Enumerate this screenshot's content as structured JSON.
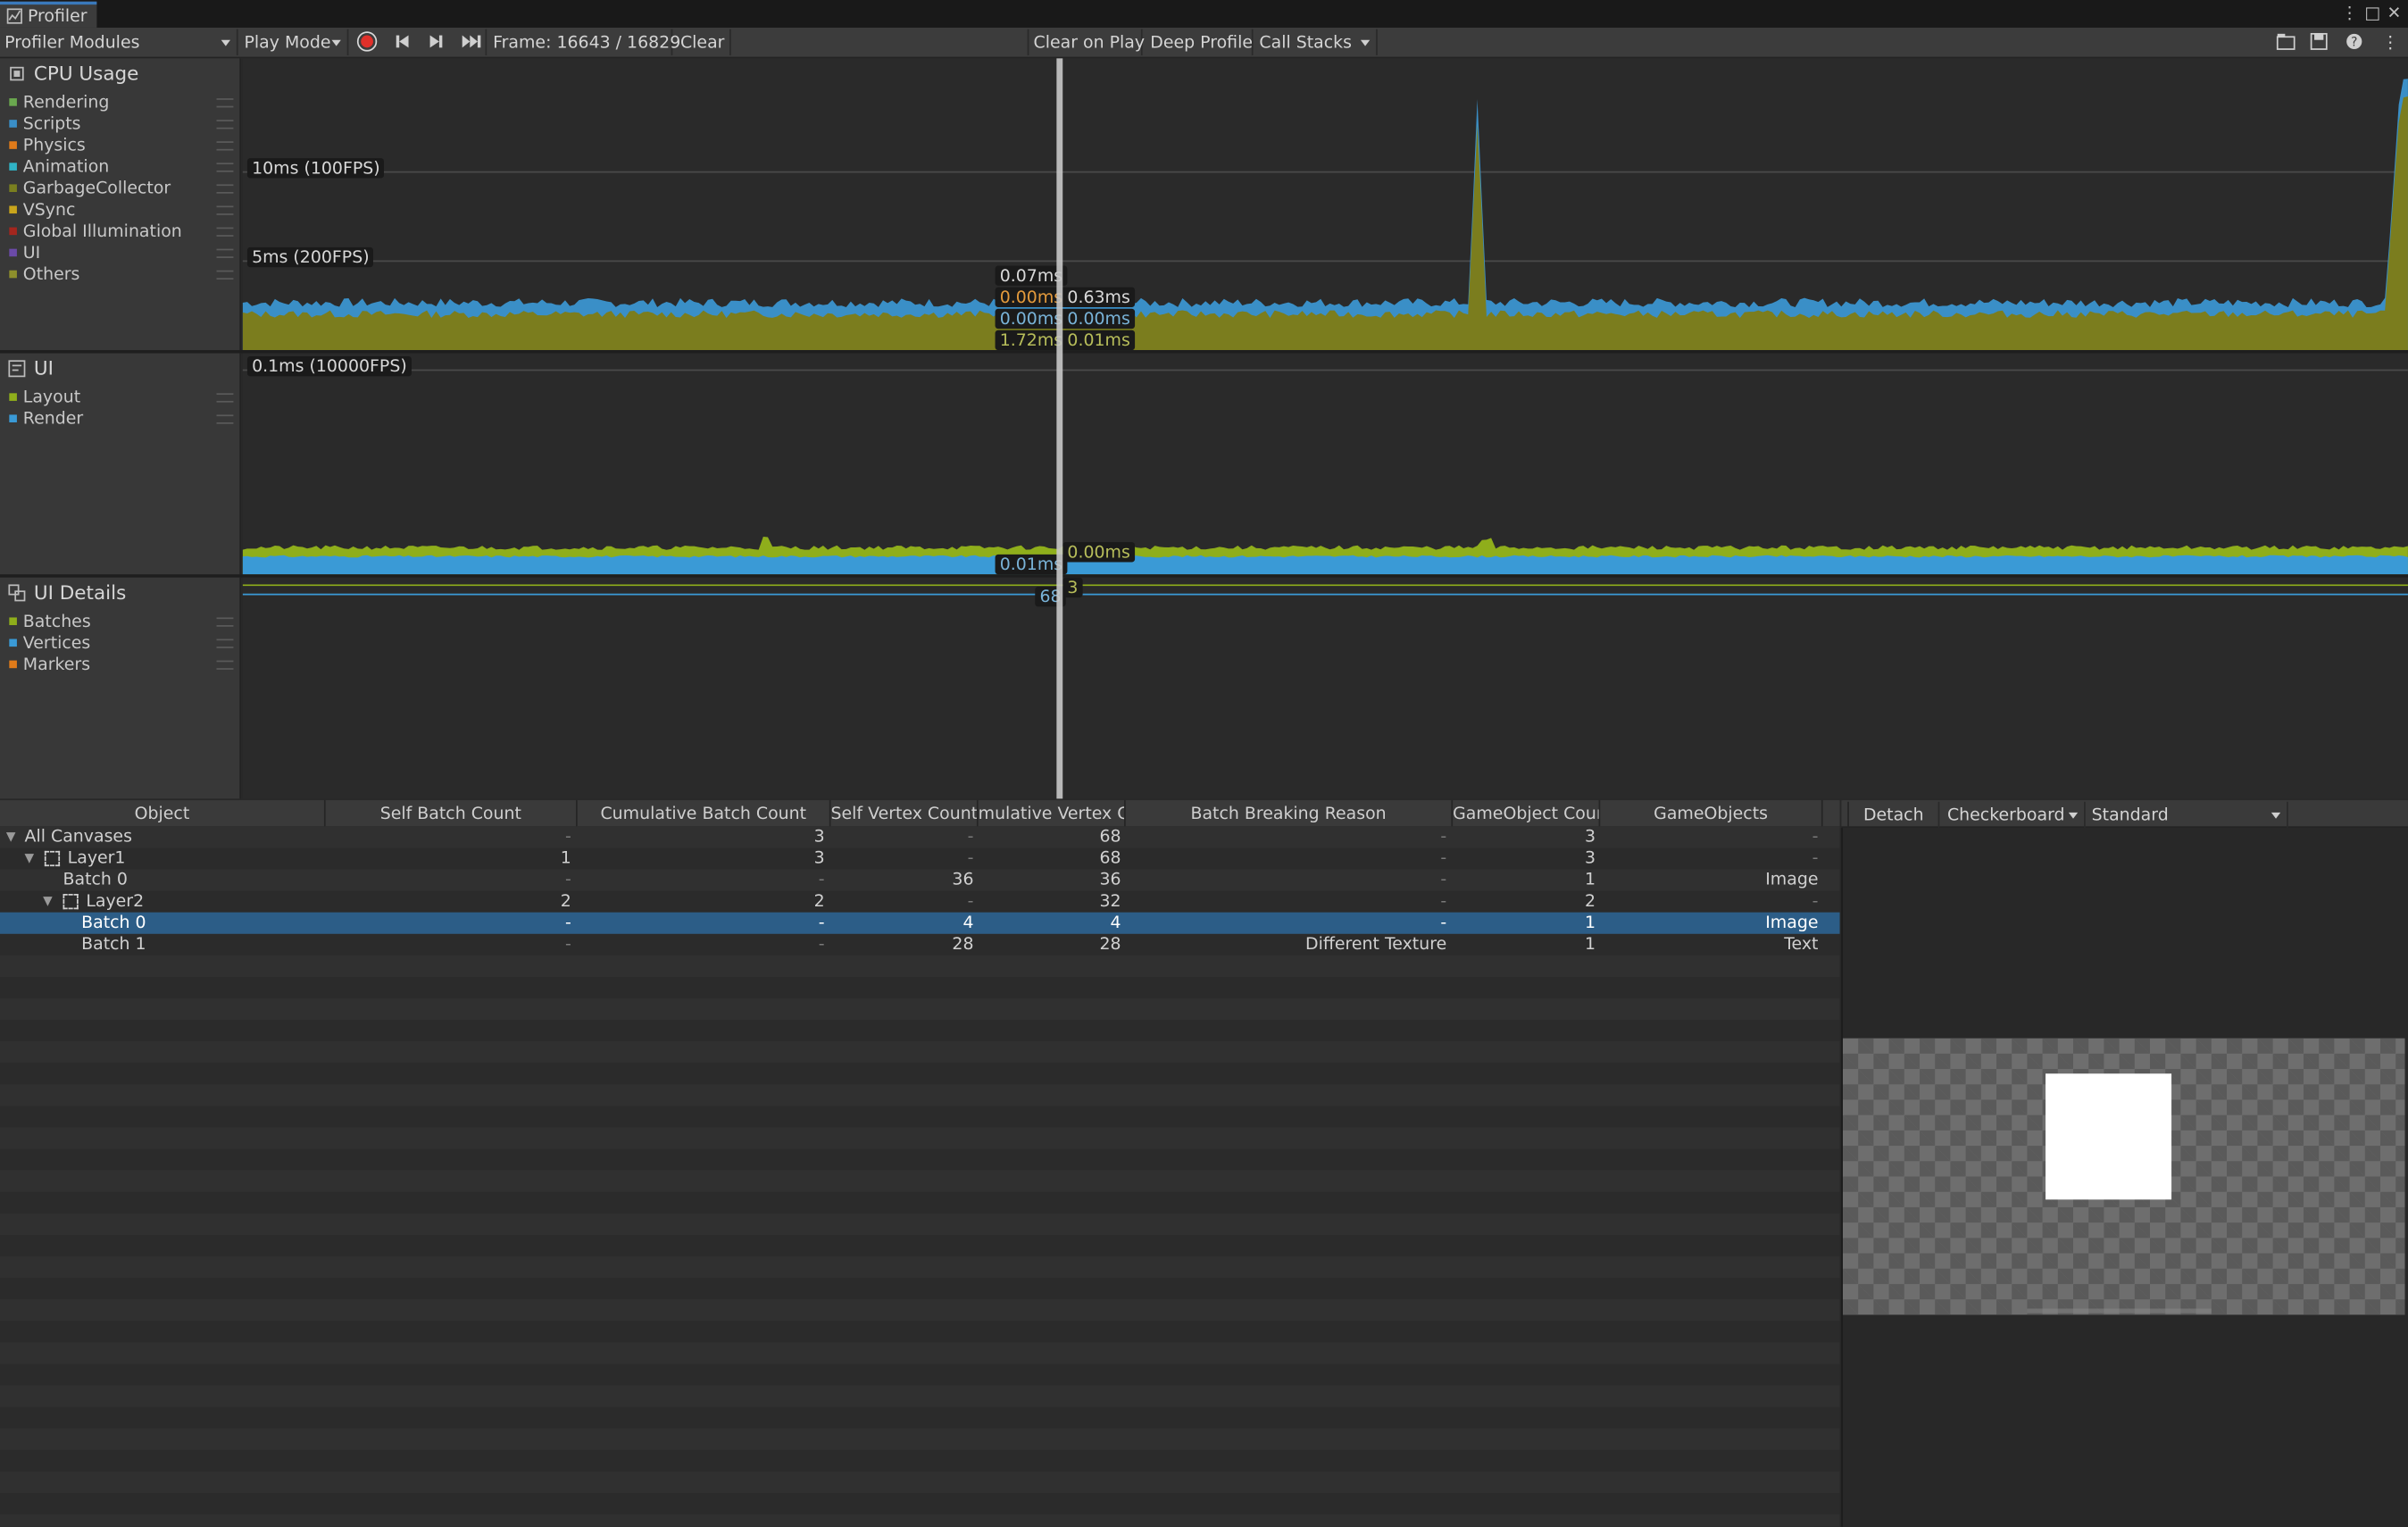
{
  "window": {
    "title": "Profiler"
  },
  "toolbar": {
    "modules": "Profiler Modules",
    "mode": "Play Mode",
    "frame": "Frame: 16643 / 16829",
    "clear": "Clear",
    "clear_on_play": "Clear on Play",
    "deep_profile": "Deep Profile",
    "call_stacks": "Call Stacks"
  },
  "cpu": {
    "title": "CPU Usage",
    "legend": [
      {
        "label": "Rendering",
        "color": "#6aa84f"
      },
      {
        "label": "Scripts",
        "color": "#3a8fc7"
      },
      {
        "label": "Physics",
        "color": "#e07b1a"
      },
      {
        "label": "Animation",
        "color": "#30b3c6"
      },
      {
        "label": "GarbageCollector",
        "color": "#7a7f1f"
      },
      {
        "label": "VSync",
        "color": "#c9a51c"
      },
      {
        "label": "Global Illumination",
        "color": "#a4261e"
      },
      {
        "label": "UI",
        "color": "#6b4aa8"
      },
      {
        "label": "Others",
        "color": "#8d8f2c"
      }
    ],
    "guides": [
      "10ms (100FPS)",
      "5ms (200FPS)"
    ],
    "cursor_left": [
      "0.07ms",
      "0.00ms",
      "0.00ms",
      "1.72ms"
    ],
    "cursor_right": [
      "0.63ms",
      "0.00ms",
      "0.01ms"
    ]
  },
  "ui_module": {
    "title": "UI",
    "legend": [
      {
        "label": "Layout",
        "color": "#8fae1b"
      },
      {
        "label": "Render",
        "color": "#3a9ad6"
      }
    ],
    "guide": "0.1ms (10000FPS)",
    "cursor_left": "0.01ms",
    "cursor_right": "0.00ms"
  },
  "ui_details": {
    "title": "UI Details",
    "legend": [
      {
        "label": "Batches",
        "color": "#8fae1b"
      },
      {
        "label": "Vertices",
        "color": "#3a9ad6"
      },
      {
        "label": "Markers",
        "color": "#e07b1a"
      }
    ],
    "cursor_left": "68",
    "cursor_right": "3"
  },
  "table": {
    "columns": [
      "Object",
      "Self Batch Count",
      "Cumulative Batch Count",
      "Self Vertex Count",
      "mulative Vertex Cc",
      "Batch Breaking Reason",
      "GameObject Coun",
      "GameObjects"
    ],
    "rows": [
      {
        "name": "All Canvases",
        "self_batch": "-",
        "cum_batch": "3",
        "self_vert": "-",
        "cum_vert": "68",
        "reason": "-",
        "go_count": "3",
        "gos": "-"
      },
      {
        "name": "Layer1",
        "self_batch": "1",
        "cum_batch": "3",
        "self_vert": "-",
        "cum_vert": "68",
        "reason": "-",
        "go_count": "3",
        "gos": "-"
      },
      {
        "name": "Batch 0",
        "self_batch": "-",
        "cum_batch": "-",
        "self_vert": "36",
        "cum_vert": "36",
        "reason": "-",
        "go_count": "1",
        "gos": "Image"
      },
      {
        "name": "Layer2",
        "self_batch": "2",
        "cum_batch": "2",
        "self_vert": "-",
        "cum_vert": "32",
        "reason": "-",
        "go_count": "2",
        "gos": "-"
      },
      {
        "name": "Batch 0",
        "self_batch": "-",
        "cum_batch": "-",
        "self_vert": "4",
        "cum_vert": "4",
        "reason": "-",
        "go_count": "1",
        "gos": "Image"
      },
      {
        "name": "Batch 1",
        "self_batch": "-",
        "cum_batch": "-",
        "self_vert": "28",
        "cum_vert": "28",
        "reason": "Different Texture",
        "go_count": "1",
        "gos": "Text"
      }
    ]
  },
  "preview": {
    "detach": "Detach",
    "background": "Checkerboard",
    "mode": "Standard"
  }
}
